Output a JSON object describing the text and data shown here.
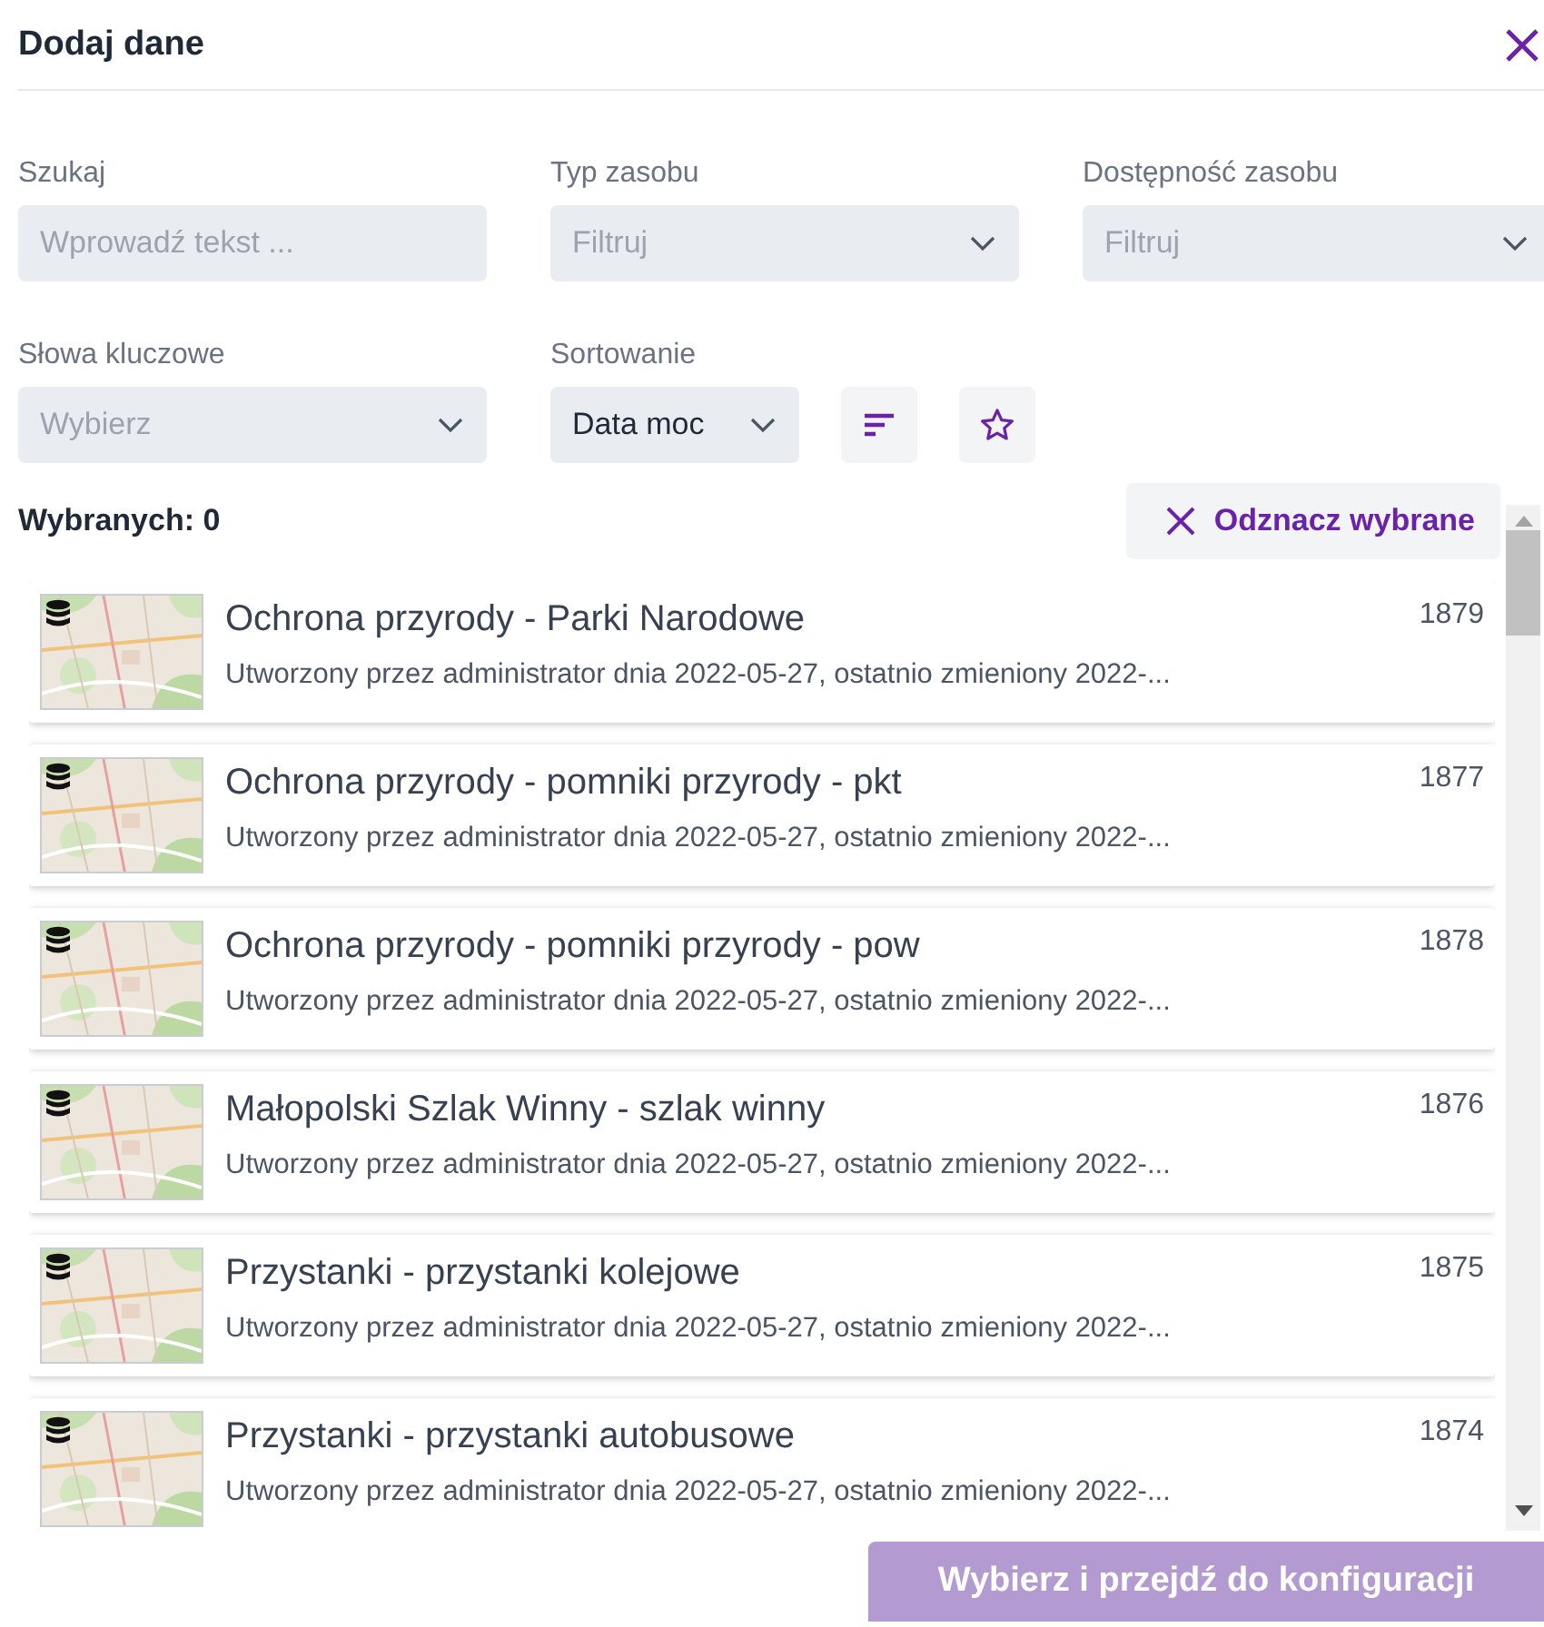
{
  "dialog": {
    "title": "Dodaj dane"
  },
  "filters": [
    {
      "kind": "input",
      "label": "Szukaj",
      "placeholder": "Wprowadź tekst ..."
    },
    {
      "kind": "select",
      "label": "Typ zasobu",
      "placeholder": "Filtruj"
    },
    {
      "kind": "select",
      "label": "Dostępność zasobu",
      "placeholder": "Filtruj"
    },
    {
      "kind": "select",
      "label": "Słowa kluczowe",
      "placeholder": "Wybierz"
    },
    {
      "kind": "select",
      "label": "Sortowanie",
      "value": "Data moc"
    }
  ],
  "selected_count": "Wybranych: 0",
  "deselect_button": {
    "label": "Odznacz wybrane"
  },
  "resources": [
    {
      "title": "Ochrona przyrody - Parki Narodowe",
      "description": "Utworzony przez administrator dnia 2022-05-27, ostatnio zmieniony 2022-...",
      "number": "1879"
    },
    {
      "title": "Ochrona przyrody - pomniki przyrody - pkt",
      "description": "Utworzony przez administrator dnia 2022-05-27, ostatnio zmieniony 2022-...",
      "number": "1877"
    },
    {
      "title": "Ochrona przyrody - pomniki przyrody - pow",
      "description": "Utworzony przez administrator dnia 2022-05-27, ostatnio zmieniony 2022-...",
      "number": "1878"
    },
    {
      "title": "Małopolski Szlak Winny - szlak winny",
      "description": "Utworzony przez administrator dnia 2022-05-27, ostatnio zmieniony 2022-...",
      "number": "1876"
    },
    {
      "title": "Przystanki - przystanki kolejowe",
      "description": "Utworzony przez administrator dnia 2022-05-27, ostatnio zmieniony 2022-...",
      "number": "1875"
    },
    {
      "title": "Przystanki - przystanki autobusowe",
      "description": "Utworzony przez administrator dnia 2022-05-27, ostatnio zmieniony 2022-...",
      "number": "1874"
    }
  ],
  "confirm_button": {
    "label": "Wybierz i przejdź do konfiguracji",
    "disabled": true
  }
}
